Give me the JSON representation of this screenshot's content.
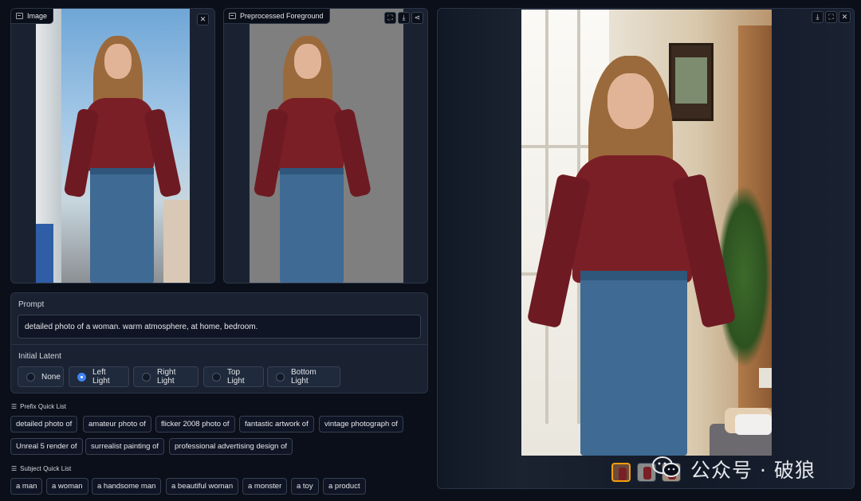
{
  "image_panel": {
    "label": "Image",
    "close_symbol": "✕"
  },
  "foreground_panel": {
    "label": "Preprocessed Foreground",
    "fullscreen_symbol": "⛶",
    "download_symbol": "⤓",
    "share_symbol": "⋖"
  },
  "output_panel": {
    "download_symbol": "⤓",
    "fullscreen_symbol": "⛶",
    "close_symbol": "✕"
  },
  "prompt": {
    "label": "Prompt",
    "value": "detailed photo of a woman. warm atmosphere, at home, bedroom."
  },
  "initial_latent": {
    "label": "Initial Latent",
    "options": [
      "None",
      "Left Light",
      "Right Light",
      "Top Light",
      "Bottom Light"
    ],
    "selected": "Left Light"
  },
  "prefix_quick_list": {
    "title": "Prefix Quick List",
    "items": [
      "detailed photo of",
      "amateur photo of",
      "flicker 2008 photo of",
      "fantastic artwork of",
      "vintage photograph of",
      "Unreal 5 render of",
      "surrealist painting of",
      "professional advertising design of"
    ]
  },
  "subject_quick_list": {
    "title": "Subject Quick List",
    "items": [
      "a man",
      "a woman",
      "a handsome man",
      "a beautiful woman",
      "a monster",
      "a toy",
      "a product"
    ]
  },
  "watermark": {
    "text": "公众号 · 破狼"
  },
  "colors": {
    "background": "#0b0f19",
    "panel": "#1a2232",
    "accent": "#3b82f6",
    "selected_thumb": "#f59e0b"
  }
}
